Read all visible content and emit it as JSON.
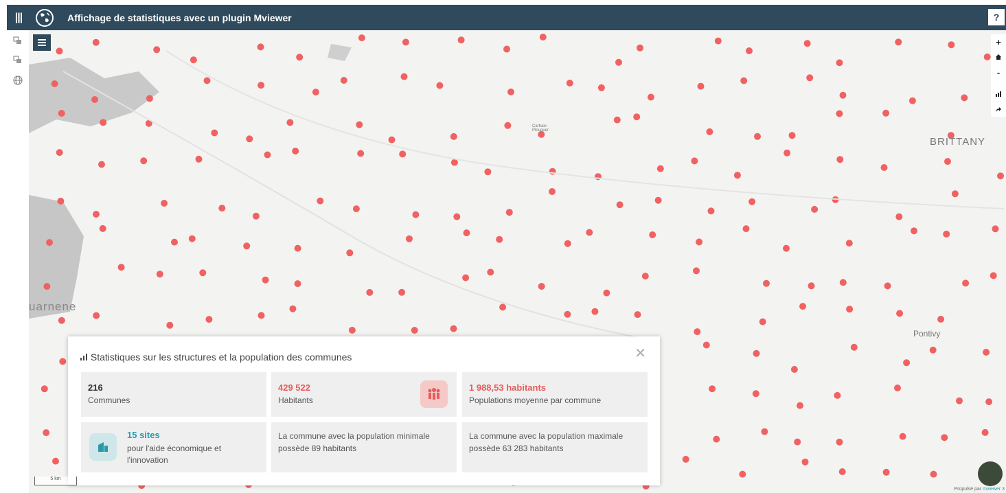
{
  "header": {
    "menu_icon": "menu-icon",
    "logo_icon": "globe-icon",
    "title": "Affichage de statistiques avec un plugin Mviewer",
    "help_label": "?"
  },
  "sidebar": {
    "tools": [
      "layers-icon",
      "layers-icon",
      "globe-icon"
    ]
  },
  "map": {
    "labels": {
      "city_left": "uarnene",
      "region": "BRITTANY",
      "city_right": "Pontivy",
      "city_center": "Carhaix-Plouguer"
    },
    "zoom_in": "+",
    "home": "home-icon",
    "zoom_out": "-",
    "stats_tool": "chart-icon",
    "share_tool": "share-icon",
    "scale_label": "5 km",
    "credit_prefix": "Propulsé par",
    "credit_brand": "mviewer 3",
    "point_color": "#f06262"
  },
  "stats_panel": {
    "title": "Statistiques sur les structures et la population des communes",
    "communes": {
      "value": "216",
      "label": "Communes"
    },
    "habitants": {
      "value": "429 522",
      "label": "Habitants"
    },
    "moyenne": {
      "value": "1 988,53 habitants",
      "label": "Populations moyenne par commune"
    },
    "sites": {
      "value": "15 sites",
      "label": "pour l'aide économique et l'innovation"
    },
    "minimale": {
      "text": "La commune avec la population minimale possède 89 habitants"
    },
    "maximale": {
      "text": "La commune avec la population maximale possède 63 283 habitants"
    },
    "accent_red": "#e85c5c",
    "accent_teal": "#2a9aa8"
  }
}
